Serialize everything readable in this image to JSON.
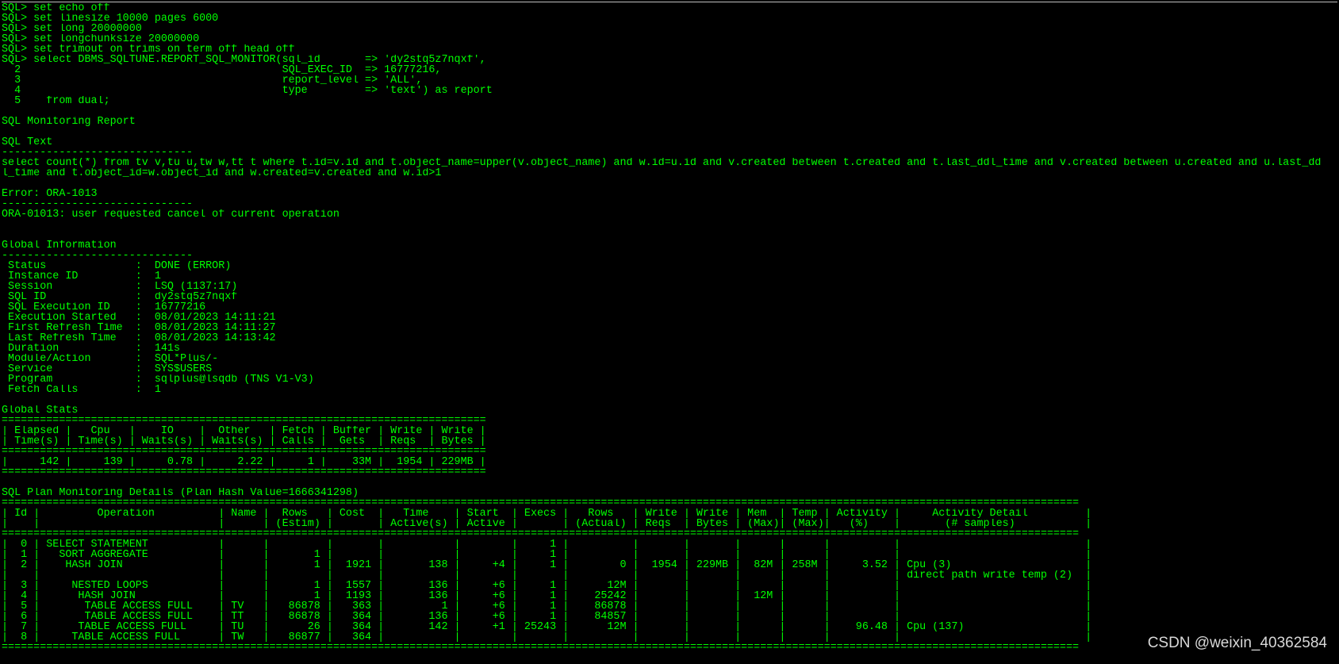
{
  "terminal": {
    "text_color": "#00ff00",
    "background_color": "#000000",
    "lines": [
      "SQL> set echo off",
      "SQL> set linesize 10000 pages 6000",
      "SQL> set long 20000000",
      "SQL> set longchunksize 20000000",
      "SQL> set trimout on trims on term off head off",
      "SQL> select DBMS_SQLTUNE.REPORT_SQL_MONITOR(sql_id       => 'dy2stq5z7nqxf',",
      "  2                                         SQL_EXEC_ID  => 16777216,",
      "  3                                         report_level => 'ALL',",
      "  4                                         type         => 'text') as report",
      "  5    from dual;",
      "",
      "SQL Monitoring Report",
      "",
      "SQL Text",
      "------------------------------",
      "select count(*) from tv v,tu u,tw w,tt t where t.id=v.id and t.object_name=upper(v.object_name) and w.id=u.id and v.created between t.created and t.last_ddl_time and v.created between u.created and u.last_dd",
      "l_time and t.object_id=w.object_id and w.created=v.created and w.id>1",
      "",
      "Error: ORA-1013",
      "------------------------------",
      "ORA-01013: user requested cancel of current operation",
      "",
      "",
      "Global Information",
      "------------------------------",
      " Status              :  DONE (ERROR)",
      " Instance ID         :  1",
      " Session             :  LSQ (1137:17)",
      " SQL ID              :  dy2stq5z7nqxf",
      " SQL Execution ID    :  16777216",
      " Execution Started   :  08/01/2023 14:11:21",
      " First Refresh Time  :  08/01/2023 14:11:27",
      " Last Refresh Time   :  08/01/2023 14:13:42",
      " Duration            :  141s",
      " Module/Action       :  SQL*Plus/-",
      " Service             :  SYS$USERS",
      " Program             :  sqlplus@lsqdb (TNS V1-V3)",
      " Fetch Calls         :  1",
      "",
      "Global Stats",
      "============================================================================",
      "| Elapsed |   Cpu   |    IO    |  Other   | Fetch | Buffer | Write | Write |",
      "| Time(s) | Time(s) | Waits(s) | Waits(s) | Calls |  Gets  | Reqs  | Bytes |",
      "============================================================================",
      "|     142 |     139 |     0.78 |     2.22 |     1 |    33M |  1954 | 229MB |",
      "============================================================================",
      "",
      "SQL Plan Monitoring Details (Plan Hash Value=1666341298)",
      "=========================================================================================================================================================================",
      "| Id |         Operation          | Name |  Rows   | Cost  |   Time    | Start  | Execs |   Rows   | Write | Write | Mem  | Temp | Activity |     Activity Detail         |",
      "|    |                            |      | (Estim) |       | Active(s) | Active |       | (Actual) | Reqs  | Bytes | (Max)| (Max)|   (%)    |       (# samples)           |",
      "=========================================================================================================================================================================",
      "|  0 | SELECT STATEMENT           |      |         |       |           |        |     1 |          |       |       |      |      |          |                             |",
      "|  1 |   SORT AGGREGATE           |      |       1 |       |           |        |     1 |          |       |       |      |      |          |                             |",
      "|  2 |    HASH JOIN               |      |       1 |  1921 |       138 |     +4 |     1 |        0 |  1954 | 229MB |  82M | 258M |     3.52 | Cpu (3)                     |",
      "|    |                            |      |         |       |           |        |       |          |       |       |      |      |          | direct path write temp (2)  |",
      "|  3 |     NESTED LOOPS           |      |       1 |  1557 |       136 |     +6 |     1 |      12M |       |       |      |      |          |                             |",
      "|  4 |      HASH JOIN             |      |       1 |  1193 |       136 |     +6 |     1 |    25242 |       |       |  12M |      |          |                             |",
      "|  5 |       TABLE ACCESS FULL    | TV   |   86878 |   363 |         1 |     +6 |     1 |    86878 |       |       |      |      |          |                             |",
      "|  6 |       TABLE ACCESS FULL    | TT   |   86878 |   364 |       136 |     +6 |     1 |    84857 |       |       |      |      |          |                             |",
      "|  7 |      TABLE ACCESS FULL     | TU   |      26 |   364 |       142 |     +1 | 25243 |      12M |       |       |      |      |    96.48 | Cpu (137)                   |",
      "|  8 |     TABLE ACCESS FULL      | TW   |   86877 |   364 |           |        |       |          |       |       |      |      |          |                             |",
      "========================================================================================================================================================================="
    ]
  },
  "watermark": {
    "text": "CSDN @weixin_40362584",
    "color": "#d8d8d8"
  }
}
